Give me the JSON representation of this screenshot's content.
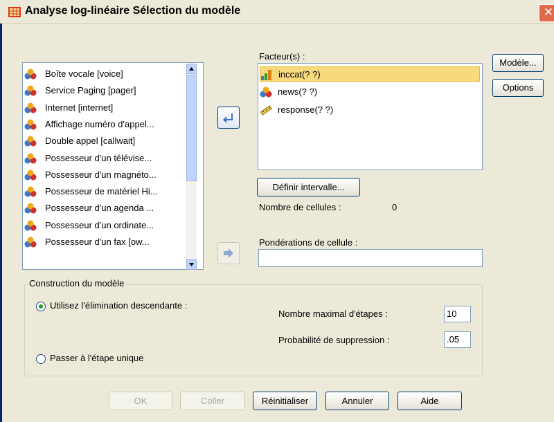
{
  "window": {
    "title": "Analyse log-linéaire Sélection du modèle",
    "close_glyph": "✕"
  },
  "source_list": {
    "items": [
      {
        "label": "Boîte vocale [voice]",
        "icon": "nominal-icon"
      },
      {
        "label": "Service Paging [pager]",
        "icon": "nominal-icon"
      },
      {
        "label": "Internet [internet]",
        "icon": "nominal-icon"
      },
      {
        "label": "Affichage numéro d'appel...",
        "icon": "nominal-icon"
      },
      {
        "label": "Double appel [callwait]",
        "icon": "nominal-icon"
      },
      {
        "label": "Possesseur  d'un télévise...",
        "icon": "nominal-icon"
      },
      {
        "label": "Possesseur d'un magnéto...",
        "icon": "nominal-icon"
      },
      {
        "label": "Possesseur de matériel Hi...",
        "icon": "nominal-icon"
      },
      {
        "label": "Possesseur d'un agenda ...",
        "icon": "nominal-icon"
      },
      {
        "label": "Possesseur d'un ordinate...",
        "icon": "nominal-icon"
      },
      {
        "label": "Possesseur d'un fax [ow...",
        "icon": "nominal-icon"
      }
    ]
  },
  "factors": {
    "label": "Facteur(s) :",
    "items": [
      {
        "label": "inccat(? ?)",
        "icon": "ordinal-icon",
        "selected": true
      },
      {
        "label": "news(? ?)",
        "icon": "nominal-icon",
        "selected": false
      },
      {
        "label": "response(? ?)",
        "icon": "scale-icon",
        "selected": false
      }
    ]
  },
  "define_range_button": "Définir intervalle...",
  "cells": {
    "label": "Nombre de cellules :",
    "value": "0"
  },
  "cell_weights": {
    "label": "Pondérations de cellule :",
    "value": ""
  },
  "side_buttons": {
    "model": "Modèle...",
    "options": "Options"
  },
  "model_building": {
    "title": "Construction du modèle",
    "backward_option": "Utilisez l'élimination descendante :",
    "backward_selected": true,
    "single_step_option": "Passer à l'étape unique",
    "max_steps_label": "Nombre maximal d'étapes :",
    "max_steps_value": "10",
    "prob_removal_label": "Probabilité de suppression :",
    "prob_removal_value": ".05"
  },
  "footer": {
    "ok": "OK",
    "paste": "Coller",
    "reset": "Réinitialiser",
    "cancel": "Annuler",
    "help": "Aide"
  },
  "colors": {
    "selection": "#f7da7c",
    "title_close": "#e06a4a",
    "arrow_active": "#5a86d6"
  }
}
